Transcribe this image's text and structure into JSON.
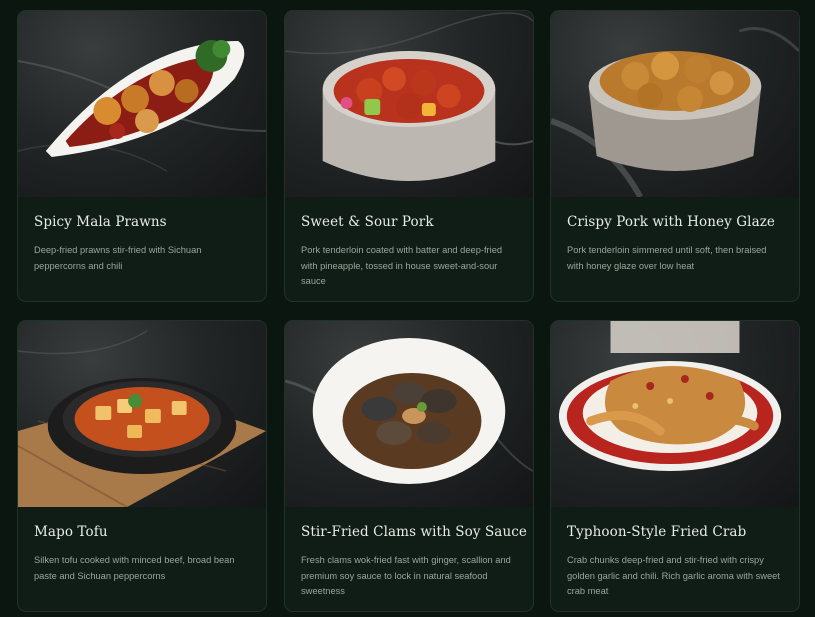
{
  "menu": {
    "items": [
      {
        "title": "Spicy Mala Prawns",
        "description": "Deep-fried prawns stir-fried with Sichuan peppercorns and chili",
        "image": "spicy-mala-prawns-photo"
      },
      {
        "title": "Sweet & Sour Pork",
        "description": "Pork tenderloin coated with batter and deep-fried with pineapple, tossed in house sweet-and-sour sauce",
        "image": "sweet-sour-pork-photo"
      },
      {
        "title": "Crispy Pork with Honey Glaze",
        "description": "Pork tenderloin simmered until soft, then braised with honey glaze over low heat",
        "image": "crispy-pork-honey-glaze-photo"
      },
      {
        "title": "Mapo Tofu",
        "description": "Silken tofu cooked with minced beef, broad bean paste and Sichuan peppercorns",
        "image": "mapo-tofu-photo"
      },
      {
        "title": "Stir-Fried Clams with Soy Sauce",
        "description": "Fresh clams wok-fried fast with ginger, scallion and premium soy sauce to lock in natural seafood sweetness",
        "image": "stir-fried-clams-photo"
      },
      {
        "title": "Typhoon-Style Fried Crab",
        "description": "Crab chunks deep-fried and stir-fried with crispy golden garlic and chili. Rich garlic aroma with sweet crab meat",
        "image": "typhoon-fried-crab-photo"
      }
    ]
  },
  "colors": {
    "page_background": "#0b1611",
    "card_background": "#0f1d16",
    "card_border": "#1f3328",
    "title_text": "#e9ece6",
    "description_text": "#9aa69c"
  }
}
